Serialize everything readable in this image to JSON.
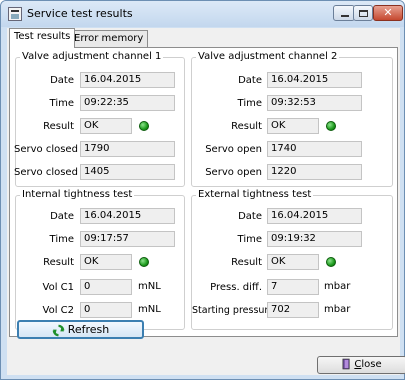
{
  "window": {
    "title": "Service test results",
    "icon": "app-window-icon",
    "controls": {
      "close_symbol": "✕"
    }
  },
  "tabs": [
    {
      "label": "Test results",
      "active": true
    },
    {
      "label": "Error memory",
      "active": false
    }
  ],
  "groups": {
    "valve1": {
      "title": "Valve adjustment channel 1",
      "date_label": "Date",
      "date": "16.04.2015",
      "time_label": "Time",
      "time": "09:22:35",
      "result_label": "Result",
      "result": "OK",
      "row4_label": "Servo closed",
      "row4_value": "1790",
      "row5_label": "Servo closed",
      "row5_value": "1405"
    },
    "valve2": {
      "title": "Valve adjustment channel 2",
      "date_label": "Date",
      "date": "16.04.2015",
      "time_label": "Time",
      "time": "09:32:53",
      "result_label": "Result",
      "result": "OK",
      "row4_label": "Servo open",
      "row4_value": "1740",
      "row5_label": "Servo open",
      "row5_value": "1220"
    },
    "internal": {
      "title": "Internal tightness test",
      "date_label": "Date",
      "date": "16.04.2015",
      "time_label": "Time",
      "time": "09:17:57",
      "result_label": "Result",
      "result": "OK",
      "row4_label": "Vol C1",
      "row4_value": "0",
      "row4_unit": "mNL",
      "row5_label": "Vol C2",
      "row5_value": "0",
      "row5_unit": "mNL"
    },
    "external": {
      "title": "External tightness test",
      "date_label": "Date",
      "date": "16.04.2015",
      "time_label": "Time",
      "time": "09:19:32",
      "result_label": "Result",
      "result": "OK",
      "row4_label": "Press. diff.",
      "row4_value": "7",
      "row4_unit": "mbar",
      "row5_label": "Starting pressure",
      "row5_value": "702",
      "row5_unit": "mbar"
    }
  },
  "status_color": "#1d9b1d",
  "buttons": {
    "refresh": "Refresh",
    "close_prefix": "C",
    "close_rest": "lose"
  }
}
